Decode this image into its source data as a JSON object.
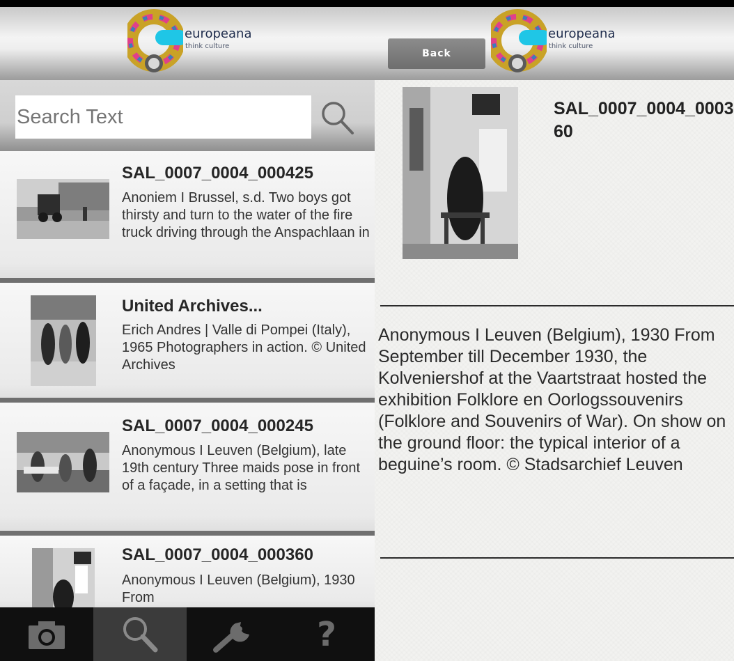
{
  "left_panel": {
    "logo": {
      "brand": "europeana",
      "tagline": "think culture"
    },
    "search": {
      "placeholder": "Search Text",
      "value": ""
    },
    "results": [
      {
        "title": "SAL_0007_0004_000425",
        "description": "Anoniem I Brussel, s.d. Two boys got thirsty and turn to the water of the fire truck driving through the Anspachlaan in"
      },
      {
        "title": "United Archives...",
        "description": "Erich Andres | Valle di Pompei (Italy), 1965 Photographers in action. © United Archives"
      },
      {
        "title": "SAL_0007_0004_000245",
        "description": "Anonymous I Leuven (Belgium), late 19th century Three maids pose in front of a façade, in a setting that is"
      },
      {
        "title": "SAL_0007_0004_000360",
        "description": "Anonymous I Leuven (Belgium), 1930 From"
      }
    ],
    "tabs": [
      {
        "icon": "camera-icon",
        "active": false
      },
      {
        "icon": "search-icon",
        "active": true
      },
      {
        "icon": "wrench-icon",
        "active": false
      },
      {
        "icon": "help-icon",
        "label": "?",
        "active": false
      }
    ]
  },
  "right_panel": {
    "back_label": "Back",
    "logo": {
      "brand": "europeana",
      "tagline": "think culture"
    },
    "title": "SAL_0007_0004_000360",
    "description": "Anonymous I Leuven (Belgium), 1930 From September till December 1930, the Kolveniershof at the Vaartstraat hosted the exhibition Folklore en Oorlogssouvenirs (Folklore and Souvenirs of War). On show on the ground floor: the typical interior of a beguine’s room. © Stadsarchief Leuven"
  },
  "colors": {
    "tabbar": "#101010",
    "tab_active": "#3b3b3b",
    "divider": "#6f6f6f",
    "logo_cyan": "#1fc6e6",
    "logo_navy": "#1f2d4d"
  }
}
